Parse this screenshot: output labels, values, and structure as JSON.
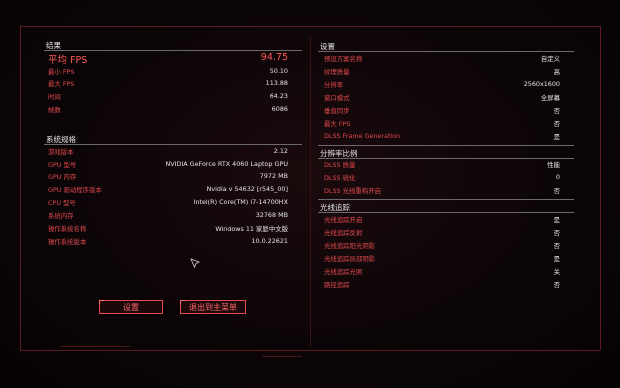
{
  "left": {
    "results": {
      "title": "结果",
      "avg_fps": {
        "label": "平均 FPS",
        "value": "94.75"
      },
      "rows": [
        {
          "label": "最小 FPS",
          "value": "50.10"
        },
        {
          "label": "最大 FPS",
          "value": "113.88"
        },
        {
          "label": "时间",
          "value": "64.23"
        },
        {
          "label": "帧数",
          "value": "6086"
        }
      ]
    },
    "system": {
      "title": "系统规格",
      "rows": [
        {
          "label": "游戏版本",
          "value": "2.12"
        },
        {
          "label": "GPU 型号",
          "value": "NVIDIA GeForce RTX 4060 Laptop GPU"
        },
        {
          "label": "GPU 内存",
          "value": "7972 MB"
        },
        {
          "label": "GPU 驱动程序版本",
          "value": "Nvidia v 54632 [r545_00]"
        },
        {
          "label": "CPU 型号",
          "value": "Intel(R) Core(TM) i7-14700HX"
        },
        {
          "label": "系统内存",
          "value": "32768 MB"
        },
        {
          "label": "操作系统名称",
          "value": "Windows 11 家庭中文版"
        },
        {
          "label": "操作系统版本",
          "value": "10.0.22621"
        }
      ]
    },
    "buttons": {
      "settings": "设置",
      "exit": "退出到主菜单"
    }
  },
  "right": {
    "settings": {
      "title": "设置",
      "rows": [
        {
          "label": "预设方案名称",
          "value": "自定义"
        },
        {
          "label": "纹理质量",
          "value": "高"
        },
        {
          "label": "分辨率",
          "value": "2560x1600"
        },
        {
          "label": "窗口模式",
          "value": "全屏幕"
        },
        {
          "label": "垂直同步",
          "value": "否"
        },
        {
          "label": "最大 FPS",
          "value": "否"
        },
        {
          "label": "DLSS Frame Generation",
          "value": "是"
        }
      ]
    },
    "resolution_scaling": {
      "title": "分辨率比例",
      "rows": [
        {
          "label": "DLSS 质量",
          "value": "性能"
        },
        {
          "label": "DLSS 锐化",
          "value": "0"
        },
        {
          "label": "DLSS 光线重构开启",
          "value": "否"
        }
      ]
    },
    "ray_tracing": {
      "title": "光线追踪",
      "rows": [
        {
          "label": "光线追踪开启",
          "value": "是"
        },
        {
          "label": "光线追踪反射",
          "value": "否"
        },
        {
          "label": "光线追踪阳光阴影",
          "value": "否"
        },
        {
          "label": "光线追踪局部阴影",
          "value": "是"
        },
        {
          "label": "光线追踪光照",
          "value": "关"
        },
        {
          "label": "路径追踪",
          "value": "否"
        }
      ]
    }
  },
  "colors": {
    "accent": "#e04a4e",
    "text": "#e6e6e6",
    "background": "#0c0507"
  }
}
